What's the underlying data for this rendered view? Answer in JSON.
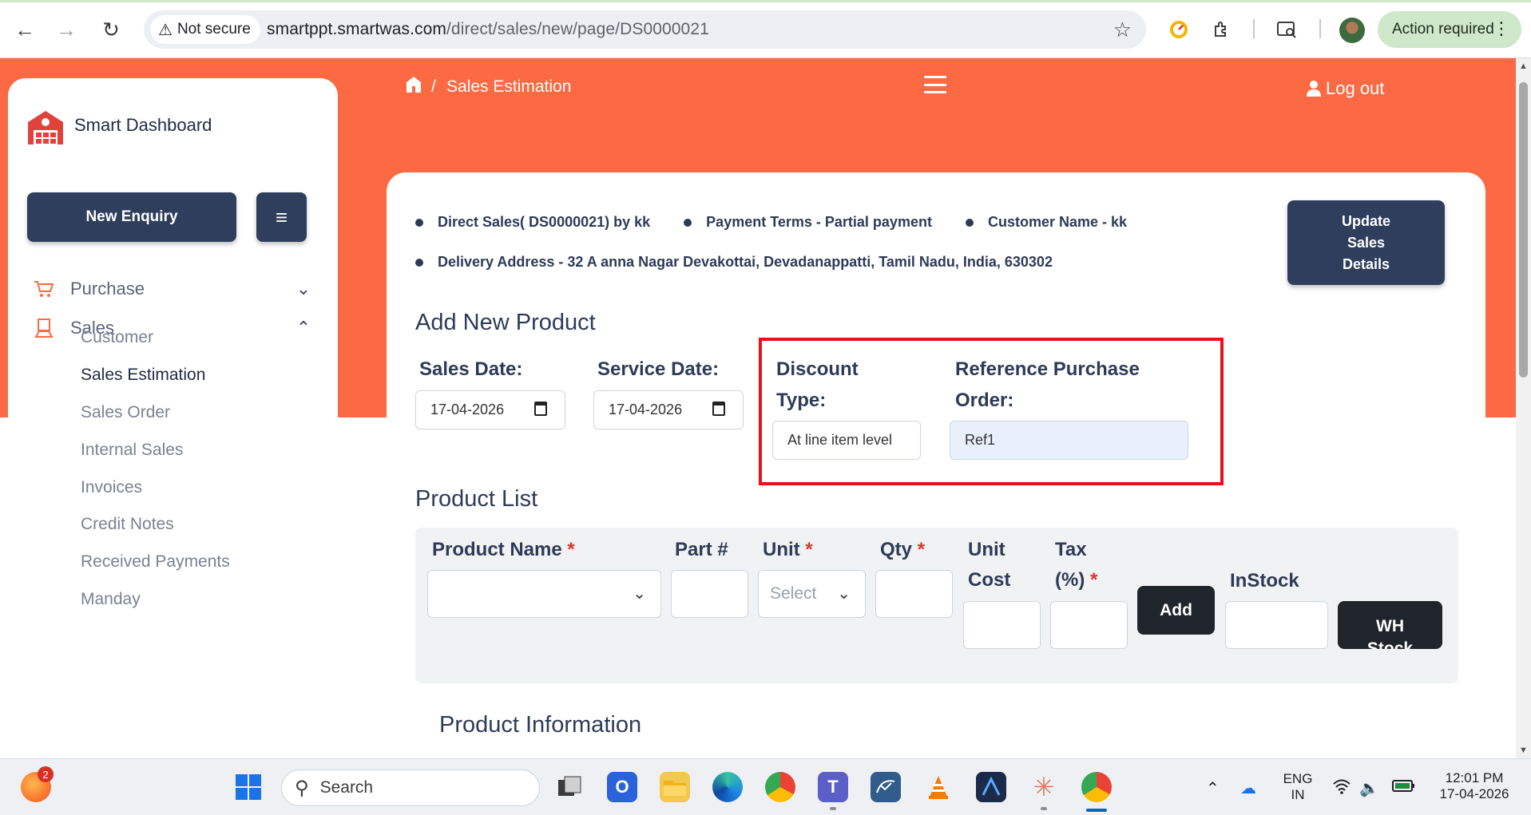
{
  "browser": {
    "security_label": "Not secure",
    "url_host": "smartppt.smartwas.com",
    "url_path": "/direct/sales/new/page/DS0000021",
    "action_required": "Action required"
  },
  "sidebar": {
    "brand": "Smart Dashboard",
    "new_enquiry": "New Enquiry",
    "menu": [
      {
        "label": "Purchase",
        "expanded": false
      },
      {
        "label": "Sales",
        "expanded": true
      }
    ],
    "sales_items": [
      {
        "label": "Customer",
        "active": false
      },
      {
        "label": "Sales Estimation",
        "active": true
      },
      {
        "label": "Sales Order",
        "active": false
      },
      {
        "label": "Internal Sales",
        "active": false
      },
      {
        "label": "Invoices",
        "active": false
      },
      {
        "label": "Credit Notes",
        "active": false
      },
      {
        "label": "Received Payments",
        "active": false
      },
      {
        "label": "Manday",
        "active": false
      }
    ]
  },
  "header": {
    "breadcrumb_separator": "/",
    "breadcrumb_page": "Sales Estimation",
    "logout": "Log out"
  },
  "summary": {
    "direct_sales": "Direct Sales( DS0000021) by kk",
    "payment_terms": "Payment Terms - Partial payment",
    "customer_name": "Customer Name - kk",
    "delivery_address": "Delivery Address - 32 A anna Nagar Devakottai, Devadanappatti, Tamil Nadu, India, 630302",
    "update_button": "Update Sales Details"
  },
  "add_product": {
    "title": "Add New Product",
    "sales_date_label": "Sales Date:",
    "sales_date_value": "17-04-2026",
    "service_date_label": "Service Date:",
    "service_date_value": "17-04-2026",
    "discount_type_label_1": "Discount",
    "discount_type_label_2": "Type:",
    "discount_type_value": "At line item level",
    "ref_po_label_1": "Reference Purchase",
    "ref_po_label_2": "Order:",
    "ref_po_value": "Ref1"
  },
  "product_list": {
    "title": "Product List",
    "product_name_label": "Product Name",
    "part_label": "Part #",
    "unit_label": "Unit",
    "unit_placeholder": "Select",
    "qty_label": "Qty",
    "unit_cost_label_1": "Unit",
    "unit_cost_label_2": "Cost",
    "tax_label_1": "Tax",
    "tax_label_2": "(%)",
    "required_mark": "*",
    "add_button": "Add",
    "instock_label": "InStock",
    "wh_stock_button_1": "WH",
    "wh_stock_button_2": "Stock"
  },
  "product_info": {
    "title": "Product Information"
  },
  "taskbar": {
    "notification_count": "2",
    "search_placeholder": "Search",
    "language_1": "ENG",
    "language_2": "IN",
    "time": "12:01 PM",
    "date": "17-04-2026"
  },
  "colors": {
    "accent_orange": "#fb6a43",
    "navy_button": "#2f3e5c",
    "highlight_red": "#e3121b"
  }
}
